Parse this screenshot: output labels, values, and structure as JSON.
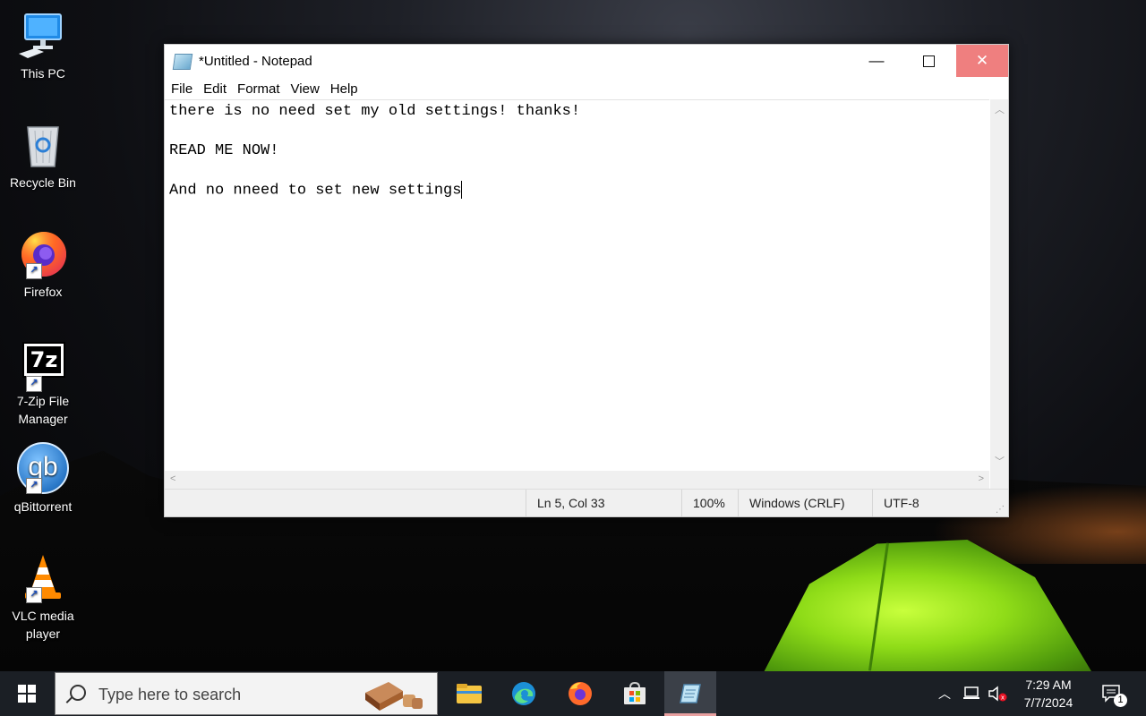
{
  "desktop": {
    "icons": [
      {
        "label": "This PC"
      },
      {
        "label": "Recycle Bin"
      },
      {
        "label": "Firefox"
      },
      {
        "label": "7-Zip File Manager",
        "logo_text": "7z"
      },
      {
        "label": "qBittorrent",
        "logo_text": "qb"
      },
      {
        "label": "VLC media player"
      }
    ]
  },
  "notepad": {
    "title": "*Untitled - Notepad",
    "menu": [
      "File",
      "Edit",
      "Format",
      "View",
      "Help"
    ],
    "lines": [
      "there is no need set my old settings! thanks!",
      "",
      "READ ME NOW!",
      "",
      "And no nneed to set new settings"
    ],
    "status": {
      "position": "Ln 5, Col 33",
      "zoom": "100%",
      "line_ending": "Windows (CRLF)",
      "encoding": "UTF-8"
    }
  },
  "taskbar": {
    "search_placeholder": "Type here to search",
    "pinned_apps": [
      "file-explorer-icon",
      "edge-icon",
      "firefox-icon",
      "store-icon",
      "notepad-icon"
    ],
    "clock": {
      "time": "7:29 AM",
      "date": "7/7/2024"
    },
    "notification_count": "1"
  },
  "colors": {
    "close_hover": "#ef7f7f",
    "taskbar": "#1b1f25",
    "active_indicator": "#e8a0a0"
  }
}
